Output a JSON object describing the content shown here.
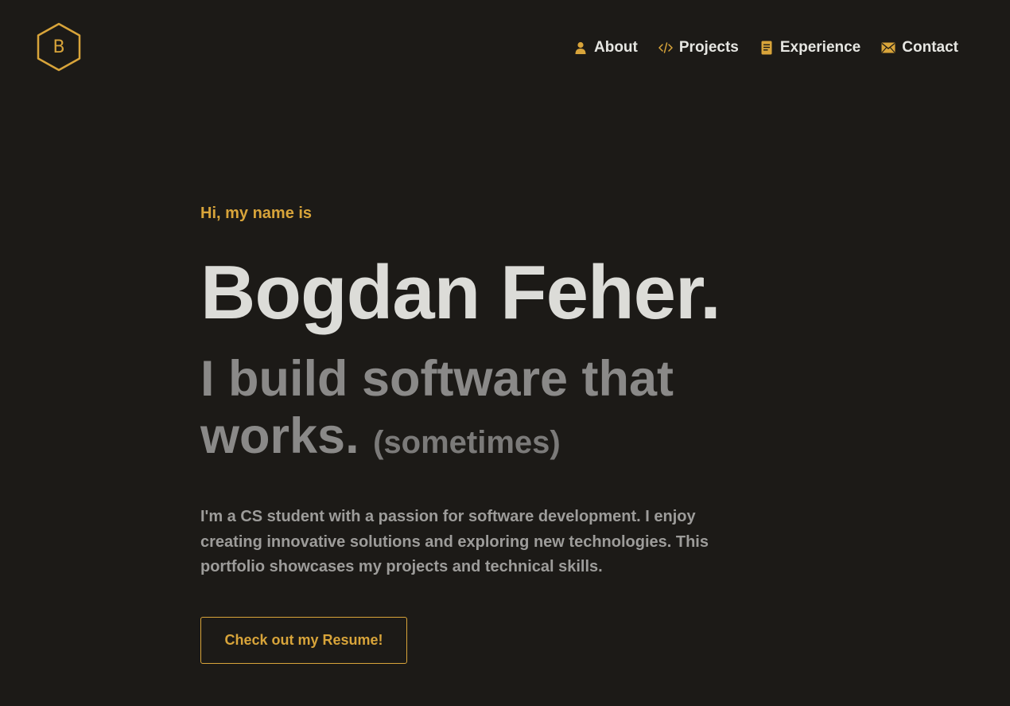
{
  "logo": {
    "letter": "B",
    "icon": "hexagon-logo-icon",
    "color": "#d8a43a"
  },
  "nav": {
    "items": [
      {
        "label": "About",
        "icon": "user-icon"
      },
      {
        "label": "Projects",
        "icon": "code-icon"
      },
      {
        "label": "Experience",
        "icon": "document-icon"
      },
      {
        "label": "Contact",
        "icon": "envelope-icon"
      }
    ]
  },
  "hero": {
    "greeting": "Hi, my name is",
    "name": "Bogdan Feher.",
    "tagline_main": "I build software that works.",
    "tagline_aside": "(sometimes)",
    "bio": "I'm a CS student with a passion for software development. I enjoy creating innovative solutions and exploring new technologies. This portfolio showcases my projects and technical skills.",
    "cta_label": "Check out my Resume!"
  },
  "colors": {
    "background": "#1c1a17",
    "accent": "#d8a43a",
    "heading": "#dcdcd8",
    "muted": "#8a8988",
    "body_text": "#9d9c9a"
  }
}
